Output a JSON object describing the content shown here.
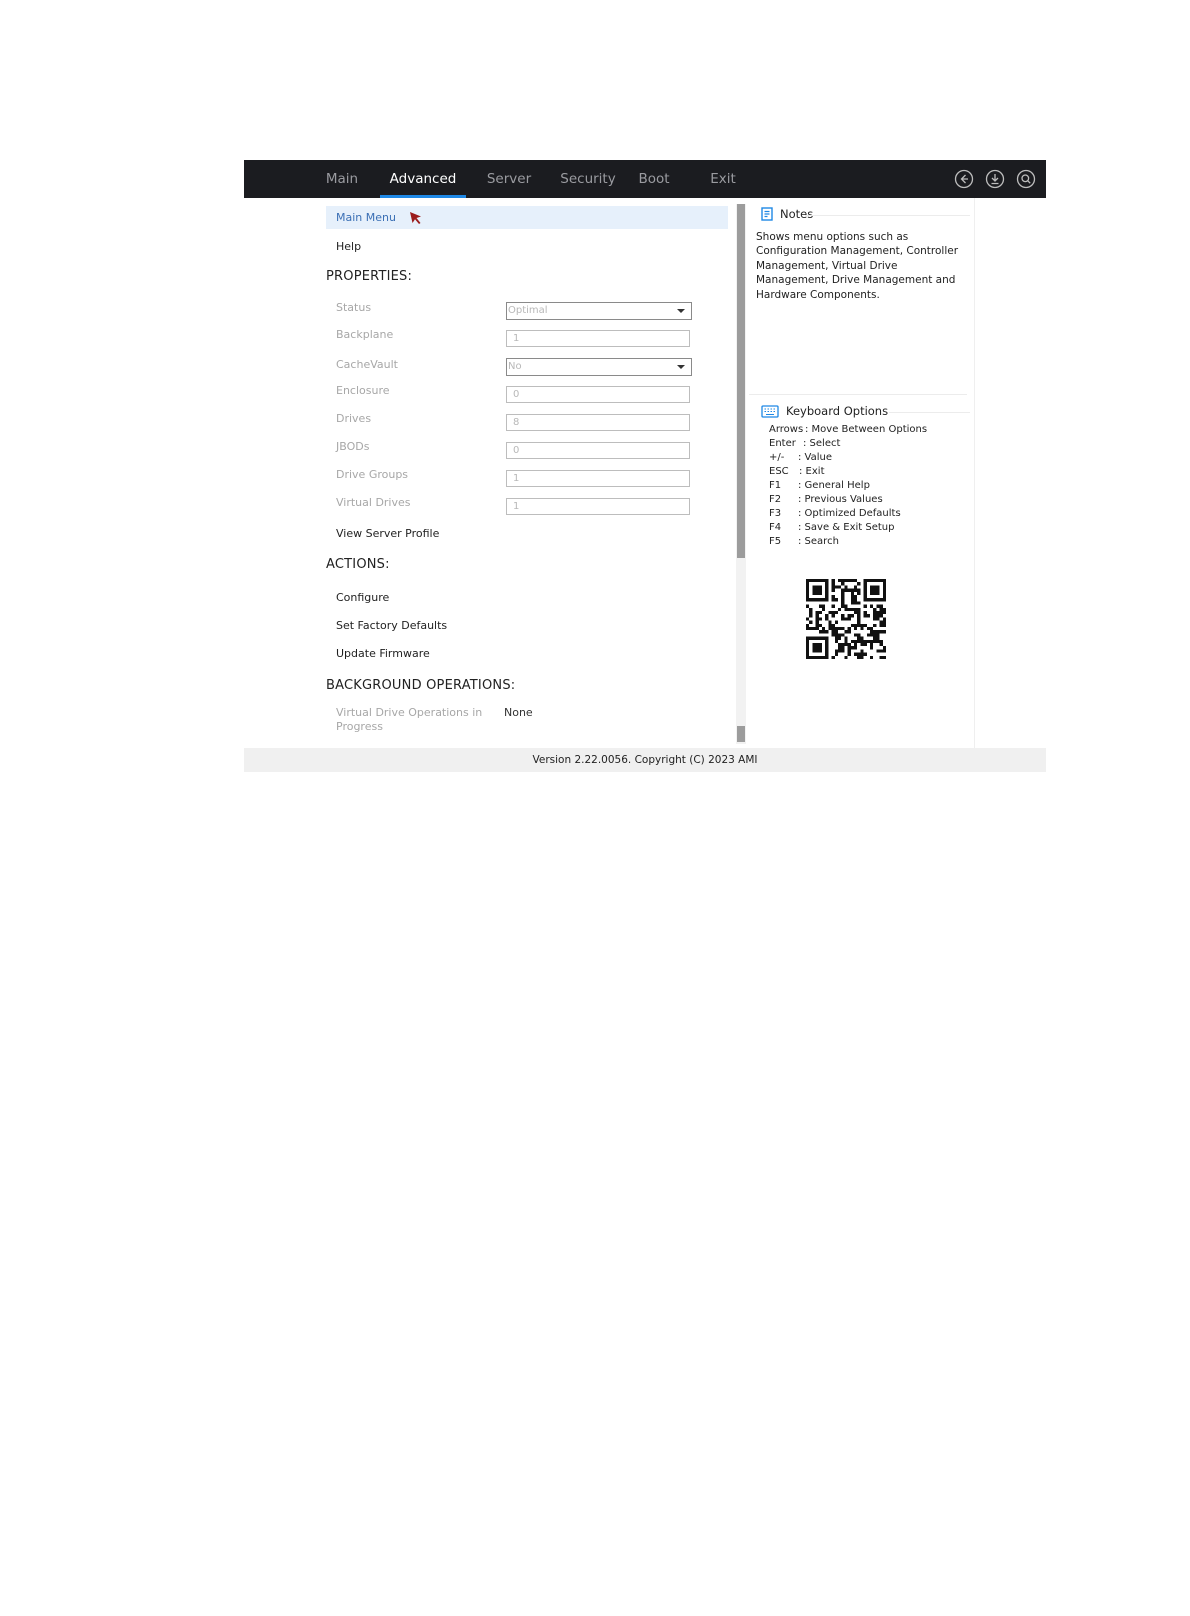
{
  "nav": {
    "tabs": [
      {
        "label": "Main"
      },
      {
        "label": "Advanced"
      },
      {
        "label": "Server"
      },
      {
        "label": "Security"
      },
      {
        "label": "Boot"
      },
      {
        "label": "Exit"
      }
    ],
    "active_tab": "Advanced",
    "icons": [
      "back-icon",
      "save-icon",
      "search-icon"
    ]
  },
  "menu": {
    "main_menu": "Main Menu",
    "help": "Help"
  },
  "properties": {
    "heading": "PROPERTIES:",
    "status": {
      "label": "Status",
      "value": "Optimal"
    },
    "backplane": {
      "label": "Backplane",
      "value": "1"
    },
    "cachevault": {
      "label": "CacheVault",
      "value": "No"
    },
    "enclosure": {
      "label": "Enclosure",
      "value": "0"
    },
    "drives": {
      "label": "Drives",
      "value": "8"
    },
    "jbods": {
      "label": "JBODs",
      "value": "0"
    },
    "drive_groups": {
      "label": "Drive Groups",
      "value": "1"
    },
    "virtual_drives": {
      "label": "Virtual Drives",
      "value": "1"
    },
    "view_server_profile": "View Server Profile"
  },
  "actions": {
    "heading": "ACTIONS:",
    "configure": "Configure",
    "set_factory_defaults": "Set Factory Defaults",
    "update_firmware": "Update Firmware"
  },
  "background": {
    "heading": "BACKGROUND OPERATIONS:",
    "vd_ops_label_1": "Virtual Drive Operations in",
    "vd_ops_label_2": "Progress",
    "vd_ops_value": "None"
  },
  "notes": {
    "title": "Notes",
    "text": "Shows menu options such as Configuration Management, Controller Management, Virtual Drive Management, Drive Management and Hardware Components."
  },
  "keyboard": {
    "title": "Keyboard Options",
    "options": [
      {
        "key": "Arrows",
        "desc": ": Move Between Options"
      },
      {
        "key": "Enter",
        "desc": ": Select"
      },
      {
        "key": "+/-",
        "desc": ": Value"
      },
      {
        "key": "ESC",
        "desc": ": Exit"
      },
      {
        "key": "F1",
        "desc": ": General Help"
      },
      {
        "key": "F2",
        "desc": ": Previous Values"
      },
      {
        "key": "F3",
        "desc": ": Optimized Defaults"
      },
      {
        "key": "F4",
        "desc": ": Save & Exit Setup"
      },
      {
        "key": "F5",
        "desc": ": Search"
      }
    ]
  },
  "footer": {
    "text": "Version 2.22.0056. Copyright (C) 2023 AMI"
  },
  "colors": {
    "topbar": "#1b1c20",
    "accent": "#1e88e5",
    "selected_row": "#e6f0fb",
    "link_blue": "#3a6fb5"
  }
}
